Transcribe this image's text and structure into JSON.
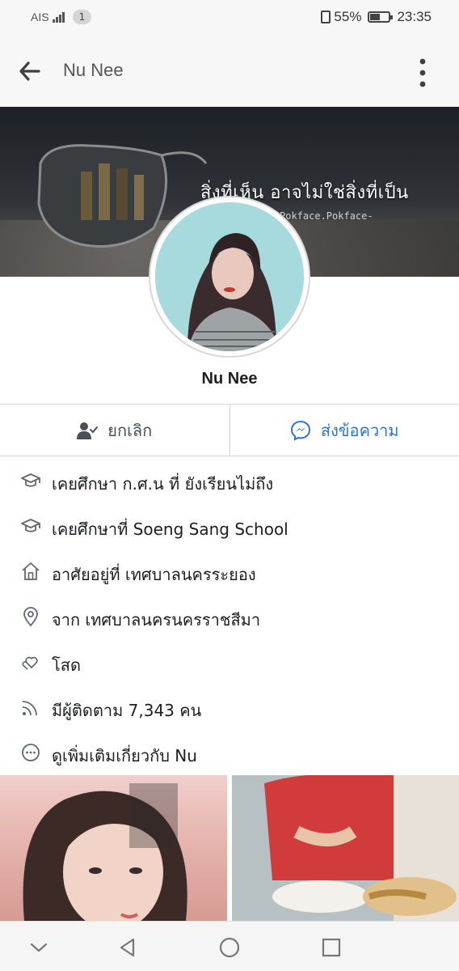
{
  "status_bar": {
    "carrier": "AIS",
    "notification_count": "1",
    "battery": "55%",
    "battery_level": 0.55,
    "time": "23:35"
  },
  "header": {
    "title": "Nu Nee"
  },
  "cover": {
    "headline": "สิ่งที่เห็น  อาจไม่ใช่สิ่งที่เป็น",
    "credit": "Pokface.Pokface-"
  },
  "profile": {
    "name": "Nu Nee"
  },
  "actions": {
    "unfriend_label": "ยกเลิก",
    "message_label": "ส่งข้อความ"
  },
  "info": [
    {
      "icon": "graduation-cap-icon",
      "text": "เคยศึกษา ก.ศ.น ที่ ยังเรียนไม่ถึง"
    },
    {
      "icon": "graduation-cap-icon",
      "text": "เคยศึกษาที่ Soeng Sang School"
    },
    {
      "icon": "home-icon",
      "text": "อาศัยอยู่ที่ เทศบาลนครระยอง"
    },
    {
      "icon": "location-pin-icon",
      "text": "จาก เทศบาลนครนครราชสีมา"
    },
    {
      "icon": "hearts-icon",
      "text": "โสด"
    },
    {
      "icon": "rss-icon",
      "text": "มีผู้ติดตาม 7,343 คน"
    },
    {
      "icon": "more-circle-icon",
      "text": "ดูเพิ่มเติมเกี่ยวกับ Nu"
    }
  ],
  "colors": {
    "accent": "#2d74d8",
    "text": "#1c1e21",
    "divider": "#d3d5d8"
  }
}
